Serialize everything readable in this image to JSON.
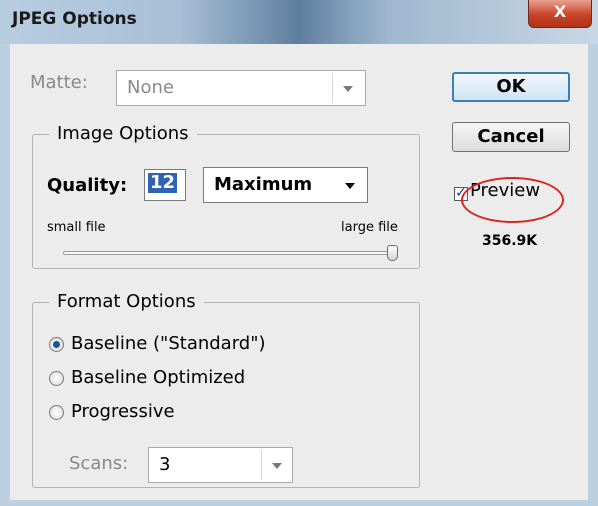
{
  "window": {
    "title": "JPEG Options",
    "close_glyph": "X"
  },
  "matte": {
    "label": "Matte:",
    "value": "None"
  },
  "image_options": {
    "title": "Image Options",
    "quality_label": "Quality:",
    "quality_value": "12",
    "quality_preset": "Maximum",
    "slider_min_label": "small file",
    "slider_max_label": "large file",
    "slider_level_fraction": 1.0
  },
  "format_options": {
    "title": "Format Options",
    "options": [
      {
        "label": "Baseline (\"Standard\")",
        "selected": true
      },
      {
        "label": "Baseline Optimized",
        "selected": false
      },
      {
        "label": "Progressive",
        "selected": false
      }
    ],
    "scans_label": "Scans:",
    "scans_value": "3"
  },
  "buttons": {
    "ok": "OK",
    "cancel": "Cancel"
  },
  "preview": {
    "label": "Preview",
    "checked": true,
    "file_size": "356.9K"
  },
  "colors": {
    "accent": "#2f63b5",
    "highlight": "#d6281c",
    "close": "#c9432a"
  },
  "icons": {
    "close": "close-icon",
    "dropdown": "chevron-down-icon",
    "check": "check-icon"
  }
}
